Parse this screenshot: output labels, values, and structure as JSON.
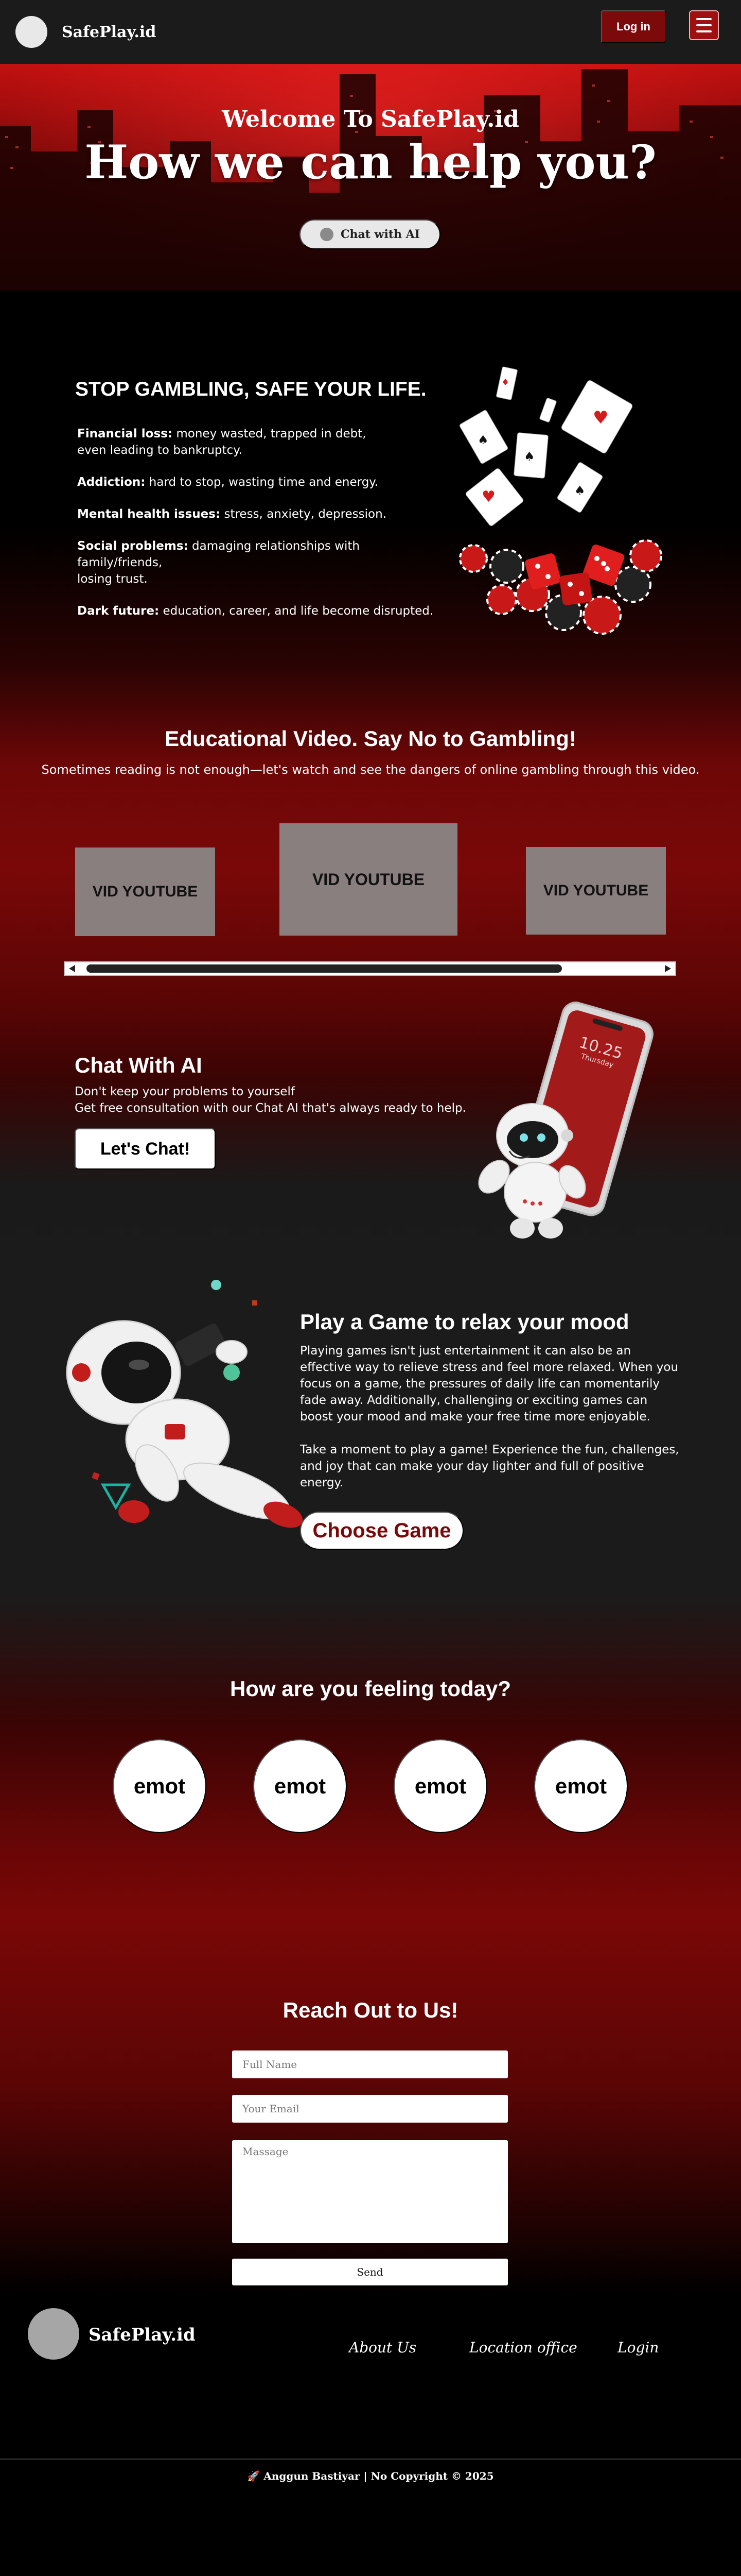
{
  "navbar": {
    "brand": "SafePlay.id",
    "login_label": "Log in",
    "logo_icon": "logo-circle-icon",
    "menu_icon": "hamburger-menu-icon"
  },
  "hero": {
    "subtitle": "Welcome To SafePlay.id",
    "title": "How we can help you?",
    "chat_button_label": "Chat with AI"
  },
  "stop": {
    "title": "STOP GAMBLING, SAFE YOUR LIFE.",
    "items": [
      {
        "label": "Financial loss:",
        "text": " money wasted, trapped in debt,",
        "text2": "even leading to bankruptcy."
      },
      {
        "label": "Addiction:",
        "text": " hard to stop, wasting time and energy.",
        "text2": ""
      },
      {
        "label": "Mental health issues:",
        "text": " stress, anxiety, depression.",
        "text2": ""
      },
      {
        "label": "Social problems:",
        "text": " damaging relationships with family/friends,",
        "text2": "losing trust."
      },
      {
        "label": "Dark future:",
        "text": " education, career, and life become disrupted.",
        "text2": ""
      }
    ]
  },
  "video": {
    "title": "Educational Video. Say No to Gambling!",
    "subtitle": "Sometimes reading is not enough—let's watch and see the dangers of online gambling through this video.",
    "videos": [
      "VID YOUTUBE",
      "VID YOUTUBE",
      "VID YOUTUBE"
    ]
  },
  "chat": {
    "title": "Chat With AI",
    "line1": "Don't keep your problems to yourself",
    "line2": "Get free consultation with our Chat AI that's always ready to help.",
    "button_label": "Let's Chat!",
    "phone_time": "10.25",
    "phone_day": "Thursday"
  },
  "game": {
    "title": "Play a Game to relax your mood",
    "para1": "Playing games isn't just entertainment it can also be an effective way to relieve stress and feel more relaxed. When you focus on a game, the pressures of daily life can momentarily fade away. Additionally, challenging or exciting games can boost your mood and make your free time more enjoyable.",
    "para2": "Take a moment to play a game! Experience the fun, challenges, and joy that can make your day lighter and full of positive energy.",
    "button_label": "Choose Game"
  },
  "feel": {
    "title": "How are you feeling today?",
    "emotes": [
      "emot",
      "emot",
      "emot",
      "emot"
    ]
  },
  "contact": {
    "title": "Reach Out to Us!",
    "name_placeholder": "Full Name",
    "email_placeholder": "Your Email",
    "message_placeholder": "Massage",
    "send_label": "Send"
  },
  "footer": {
    "brand": "SafePlay.id",
    "links": [
      "About Us",
      "Location office",
      "Login"
    ],
    "copyright": "🚀 Anggun Bastiyar | No Copyright © 2025"
  },
  "colors": {
    "brand_red": "#7c0a0a",
    "dark_bg": "#1b1b1b",
    "accent_red": "#a01010"
  }
}
